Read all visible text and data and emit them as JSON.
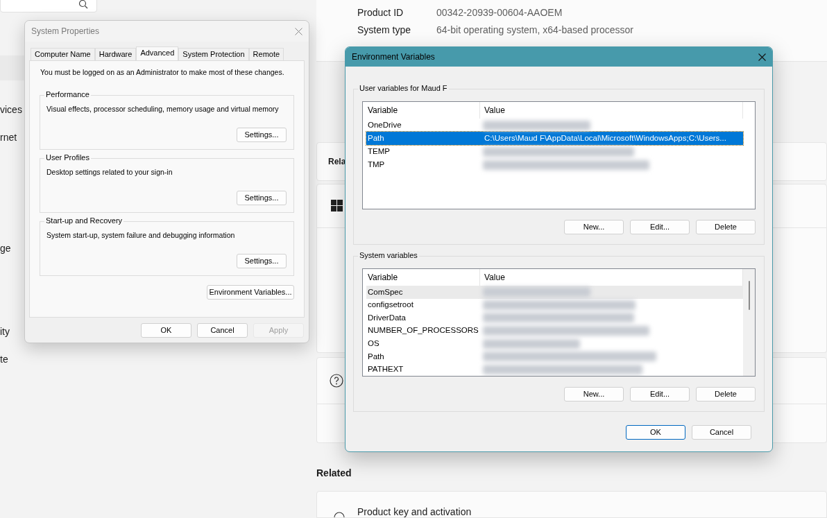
{
  "settings_page": {
    "sidebar": {
      "items": [
        {
          "label": "vices"
        },
        {
          "label": "rnet"
        },
        {
          "label": "ge"
        },
        {
          "label": "ity"
        },
        {
          "label": "te"
        }
      ]
    },
    "specs": [
      {
        "label": "Product ID",
        "value": "00342-20939-00604-AAOEM"
      },
      {
        "label": "System type",
        "value": "64-bit operating system, x64-based processor"
      }
    ],
    "related_header_cut": "Rela",
    "related_title": "Related",
    "related_items": [
      {
        "label": "Product key and activation"
      }
    ]
  },
  "system_properties": {
    "title": "System Properties",
    "tabs": [
      {
        "label": "Computer Name",
        "selected": false
      },
      {
        "label": "Hardware",
        "selected": false
      },
      {
        "label": "Advanced",
        "selected": true
      },
      {
        "label": "System Protection",
        "selected": false
      },
      {
        "label": "Remote",
        "selected": false
      }
    ],
    "notice": "You must be logged on as an Administrator to make most of these changes.",
    "groups": [
      {
        "title": "Performance",
        "description": "Visual effects, processor scheduling, memory usage and virtual memory",
        "button": "Settings..."
      },
      {
        "title": "User Profiles",
        "description": "Desktop settings related to your sign-in",
        "button": "Settings..."
      },
      {
        "title": "Start-up and Recovery",
        "description": "System start-up, system failure and debugging information",
        "button": "Settings..."
      }
    ],
    "env_button": "Environment Variables...",
    "buttons": [
      {
        "label": "OK",
        "disabled": false
      },
      {
        "label": "Cancel",
        "disabled": false
      },
      {
        "label": "Apply",
        "disabled": true
      }
    ]
  },
  "environment_variables": {
    "title": "Environment Variables",
    "lists": [
      {
        "title": "User variables for Maud F",
        "columns": [
          "Variable",
          "Value"
        ],
        "scrollbar": false,
        "rows": [
          {
            "variable": "OneDrive",
            "kind": "redacted",
            "selected": false,
            "hovered": false
          },
          {
            "variable": "Path",
            "kind": "text",
            "value": "C:\\Users\\Maud F\\AppData\\Local\\Microsoft\\WindowsApps;C:\\Users...",
            "selected": true,
            "hovered": false
          },
          {
            "variable": "TEMP",
            "kind": "redacted",
            "selected": false,
            "hovered": false
          },
          {
            "variable": "TMP",
            "kind": "redacted",
            "selected": false,
            "hovered": false
          }
        ],
        "buttons": [
          "New...",
          "Edit...",
          "Delete"
        ]
      },
      {
        "title": "System variables",
        "columns": [
          "Variable",
          "Value"
        ],
        "scrollbar": true,
        "rows": [
          {
            "variable": "ComSpec",
            "kind": "redacted",
            "selected": false,
            "hovered": true
          },
          {
            "variable": "configsetroot",
            "kind": "redacted",
            "selected": false,
            "hovered": false
          },
          {
            "variable": "DriverData",
            "kind": "redacted",
            "selected": false,
            "hovered": false
          },
          {
            "variable": "NUMBER_OF_PROCESSORS",
            "kind": "redacted",
            "selected": false,
            "hovered": false
          },
          {
            "variable": "OS",
            "kind": "redacted",
            "selected": false,
            "hovered": false
          },
          {
            "variable": "Path",
            "kind": "redacted",
            "selected": false,
            "hovered": false
          },
          {
            "variable": "PATHEXT",
            "kind": "redacted",
            "selected": false,
            "hovered": false
          }
        ],
        "buttons": [
          "New...",
          "Edit...",
          "Delete"
        ]
      }
    ],
    "buttons": [
      {
        "label": "OK",
        "default": true
      },
      {
        "label": "Cancel",
        "default": false
      }
    ]
  }
}
